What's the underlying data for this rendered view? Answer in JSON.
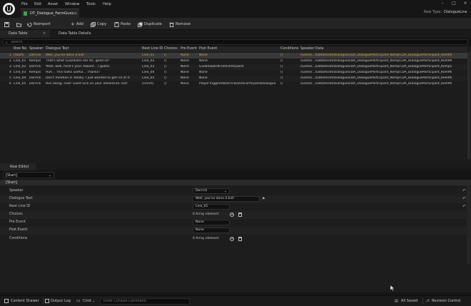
{
  "menu": [
    "File",
    "Edit",
    "Asset",
    "Window",
    "Tools",
    "Help"
  ],
  "document_tab": "DT_Dialogue_FarmGues...",
  "row_type": {
    "label": "Row Type:",
    "value": "DialogueLine"
  },
  "toolbar": {
    "reimport": "Reimport",
    "add": "Add",
    "copy": "Copy",
    "paste": "Paste",
    "duplicate": "Duplicate",
    "remove": "Remove"
  },
  "panel_tabs": {
    "data_table": "Data Table",
    "details": "Data Table Details"
  },
  "search": {
    "placeholder": "Search"
  },
  "table": {
    "headers": [
      "Row Na",
      "Speaker",
      "Dialogue Text",
      "Next Line ID",
      "Choices",
      "Pre Event",
      "Post Event",
      "Conditions",
      "Speaker Data"
    ],
    "rows": [
      [
        "1",
        "[Start]",
        "Derrick",
        "Well, you've done it kid!",
        "Line_01",
        "()",
        "None",
        "None",
        "()",
        "/Game/.../DataAsset/Dialogues/DA_DialogueParticipant_Kemps.DA_DialogueParticipant_KemMi"
      ],
      [
        "2",
        "Line_01",
        "Kempis",
        "That's what Guardians are for, good sir!",
        "Line_02",
        "()",
        "None",
        "None",
        "()",
        "/Game/.../DataAsset/Dialogues/DA_DialogueParticipant_Kemps.DA_DialogueParticipant_KemMi"
      ],
      [
        "3",
        "Line_02",
        "Derrick",
        "Yeah, well, here's your reward... I guess.",
        "Line_03",
        "()",
        "None",
        "GiveRewardFromFarmQuest",
        "()",
        "/Game/.../DataAsset/Dialogues/DA_DialogueParticipant_Kemps.DA_DialogueParticipant_Kemps"
      ],
      [
        "4",
        "Line_03",
        "Kempis",
        "Huh... This looks useful... Thanks!",
        "Line_04",
        "()",
        "None",
        "None",
        "()",
        "/Game/.../DataAsset/Dialogues/DA_DialogueParticipant_Kemps.DA_DialogueParticipant_KemMi"
      ],
      [
        "5",
        "Line_04",
        "Derrick",
        "Don't mention it. Really, I just wanted to get rid of it.",
        "Line_05",
        "()",
        "None",
        "None",
        "()",
        "/Game/.../DataAsset/Dialogues/DA_DialogueParticipant_Kemps.DA_DialogueParticipant_KemMi"
      ],
      [
        "6",
        "Line_05",
        "Derrick",
        "Run along, now! Good luck on your adventure, kid!",
        "[Finish]",
        "()",
        "None",
        "PlayerTriggeredDerrickDoneFarmQuestDialogue",
        "()",
        "/Game/.../DataAsset/Dialogues/DA_DialogueParticipant_Kemps.DA_DialogueParticipant_KemMi"
      ]
    ]
  },
  "row_editor": {
    "tab": "Row Editor",
    "selected_row": "[Start]",
    "section": "[Start]",
    "props": {
      "speaker_label": "Speaker",
      "speaker_value": "Derrick",
      "text_label": "Dialogue Text",
      "text_value": "Well, you've done it kid!",
      "next_label": "Next Line ID",
      "next_value": "Line_01",
      "choices_label": "Choices",
      "choices_value": "0 Array element",
      "pre_label": "Pre Event",
      "pre_value": "None",
      "post_label": "Post Event",
      "post_value": "None",
      "cond_label": "Conditions",
      "cond_value": "0 Array element"
    }
  },
  "statusbar": {
    "content_drawer": "Content Drawer",
    "output_log": "Output Log",
    "cmd": "Cmd",
    "cmd_placeholder": "Enter Console Command",
    "all_saved": "All Saved",
    "revision": "Revision Control"
  },
  "colors": {
    "accent": "#d9a53a",
    "selected_row": "#3a3a3a",
    "green": "#3aa055"
  }
}
